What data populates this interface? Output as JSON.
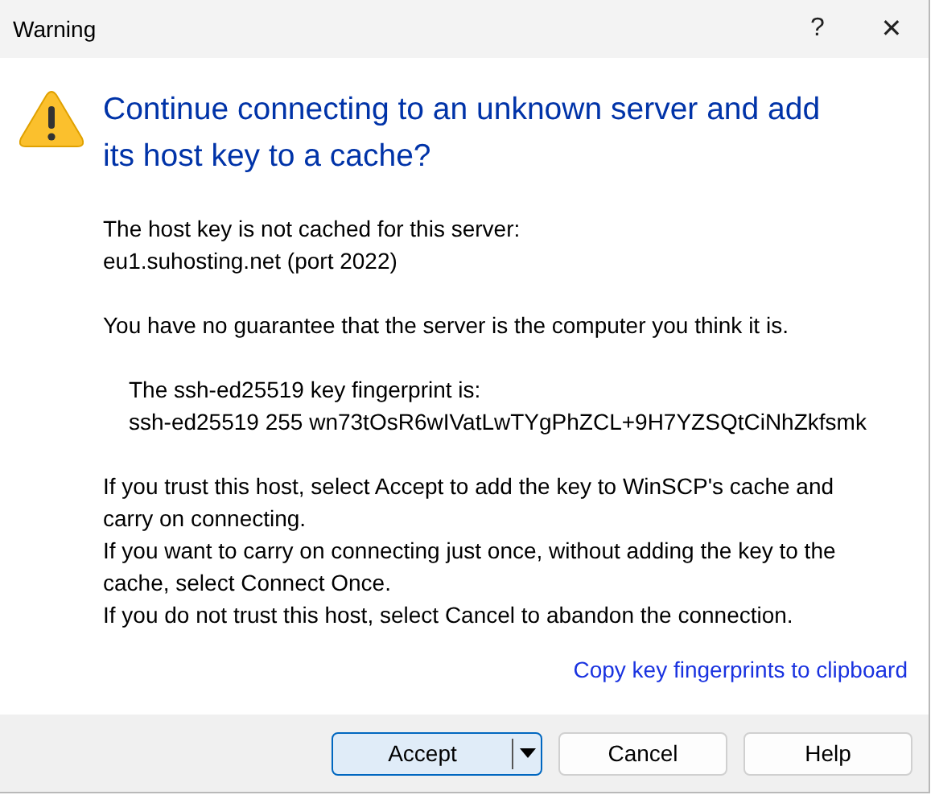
{
  "window": {
    "title": "Warning",
    "help_glyph": "?",
    "close_glyph": "✕"
  },
  "heading": [
    "Continue connecting to an unknown server and add",
    "its host key to a cache?"
  ],
  "paragraphs": [
    {
      "indented": false,
      "lines": [
        "The host key is not cached for this server:",
        "eu1.suhosting.net (port 2022)"
      ]
    },
    {
      "indented": false,
      "lines": [
        "You have no guarantee that the server is the computer you think it is."
      ]
    },
    {
      "indented": true,
      "lines": [
        "The ssh-ed25519 key fingerprint is:",
        "ssh-ed25519 255 wn73tOsR6wIVatLwTYgPhZCL+9H7YZSQtCiNhZkfsmk"
      ]
    },
    {
      "indented": false,
      "lines": [
        "If you trust this host, select Accept to add the key to WinSCP's cache and",
        "carry on connecting.",
        "If you want to carry on connecting just once, without adding the key to the",
        "cache, select Connect Once.",
        "If you do not trust this host, select Cancel to abandon the connection."
      ]
    }
  ],
  "link": "Copy key fingerprints to clipboard",
  "buttons": [
    {
      "label": "Accept",
      "default": true,
      "split": true
    },
    {
      "label": "Cancel",
      "default": false,
      "split": false
    },
    {
      "label": "Help",
      "default": false,
      "split": false
    }
  ]
}
